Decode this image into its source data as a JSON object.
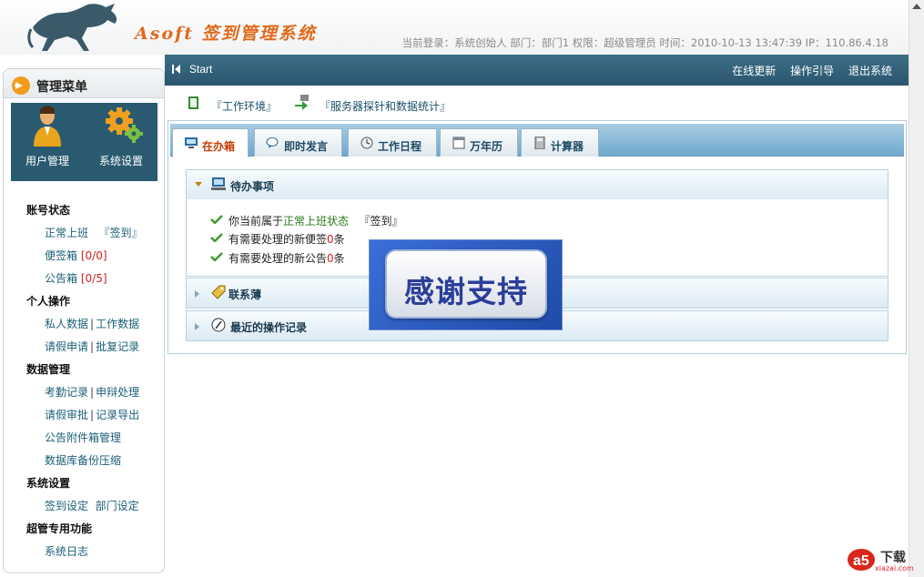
{
  "header": {
    "logo_text": "Asoft 签到管理系统",
    "info": "当前登录：系统创始人  部门：部门1 权限：超级管理员  时间：2010-10-13 13:47:39 IP：110.86.4.18"
  },
  "navbar": {
    "start_label": "Start",
    "links": [
      "在线更新",
      "操作引导",
      "退出系统"
    ]
  },
  "sidebar": {
    "title": "管理菜单",
    "icons": [
      {
        "label": "用户管理",
        "icon": "user-icon"
      },
      {
        "label": "系统设置",
        "icon": "gears-icon"
      }
    ],
    "sections": [
      {
        "title": "账号状态",
        "items": [
          {
            "text": "正常上班",
            "extra": "『签到』"
          },
          {
            "text": "便签箱",
            "badge": "[0/0]"
          },
          {
            "text": "公告箱",
            "badge": "[0/5]"
          }
        ]
      },
      {
        "title": "个人操作",
        "items": [
          {
            "text": "私人数据",
            "extra": "工作数据"
          },
          {
            "text": "请假申请",
            "extra": "批复记录"
          }
        ]
      },
      {
        "title": "数据管理",
        "items": [
          {
            "text": "考勤记录",
            "extra": "申辩处理"
          },
          {
            "text": "请假审批",
            "extra": "记录导出"
          },
          {
            "text": "公告附件箱管理"
          },
          {
            "text": "数据库备份压缩"
          }
        ]
      },
      {
        "title": "系统设置",
        "items": [
          {
            "text": "签到设定",
            "extra": "部门设定"
          }
        ]
      },
      {
        "title": "超管专用功能",
        "items": [
          {
            "text": "系统日志"
          }
        ]
      }
    ]
  },
  "quick_links": [
    "『工作环境』",
    "『服务器探针和数据统计』"
  ],
  "tabs": [
    "在办箱",
    "即时发言",
    "工作日程",
    "万年历",
    "计算器"
  ],
  "panels": {
    "todo_title": "待办事项",
    "todo_items": {
      "status_prefix": "你当前属于",
      "status_value": "正常上班状态",
      "status_action": "『签到』",
      "memo_prefix": "有需要处理的新便签",
      "memo_count": "0",
      "memo_suffix": "条",
      "notice_prefix": "有需要处理的新公告",
      "notice_count": "0",
      "notice_suffix": "条"
    },
    "contacts_title": "联系薄",
    "log_title": "最近的操作记录"
  },
  "overlay": {
    "text": "感谢支持"
  },
  "watermark": {
    "brand": "下载",
    "url": "xiazai.com"
  },
  "colors": {
    "nav": "#2a5670",
    "accent": "#c43d00",
    "link": "#1a5f78",
    "badge": "#d02020"
  }
}
